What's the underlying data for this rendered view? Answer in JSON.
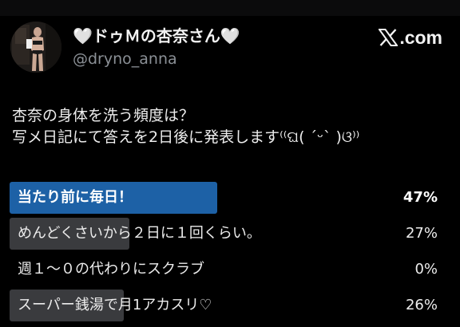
{
  "account": {
    "display_name": "🤍ドゥＭの杏奈さん🤍",
    "handle": "@dryno_anna"
  },
  "brand": {
    "logo_icon": "x-logo-icon",
    "label": ".com"
  },
  "tweet": {
    "lines": [
      "杏奈の身体を洗う頻度は？",
      "写メ日記にて答えを2日後に発表します⁽⁽ଘ( ˊᵕˋ )ଓ⁾⁾"
    ]
  },
  "poll": {
    "options": [
      {
        "label": "当たり前に毎日！",
        "percent_text": "47%",
        "fill_percent": 47,
        "leading": true
      },
      {
        "label": "めんどくさいから２日に１回くらい。",
        "percent_text": "27%",
        "fill_percent": 27,
        "leading": false
      },
      {
        "label": "週１〜０の代わりにスクラブ",
        "percent_text": "0%",
        "fill_percent": 0,
        "leading": false
      },
      {
        "label": "スーパー銭湯で月1アカスリ♡",
        "percent_text": "26%",
        "fill_percent": 26,
        "leading": false
      }
    ]
  },
  "colors": {
    "background": "#000000",
    "leading_bar": "#1d61a6",
    "other_bar": "#3a3b3e",
    "handle_text": "#8b9096"
  }
}
